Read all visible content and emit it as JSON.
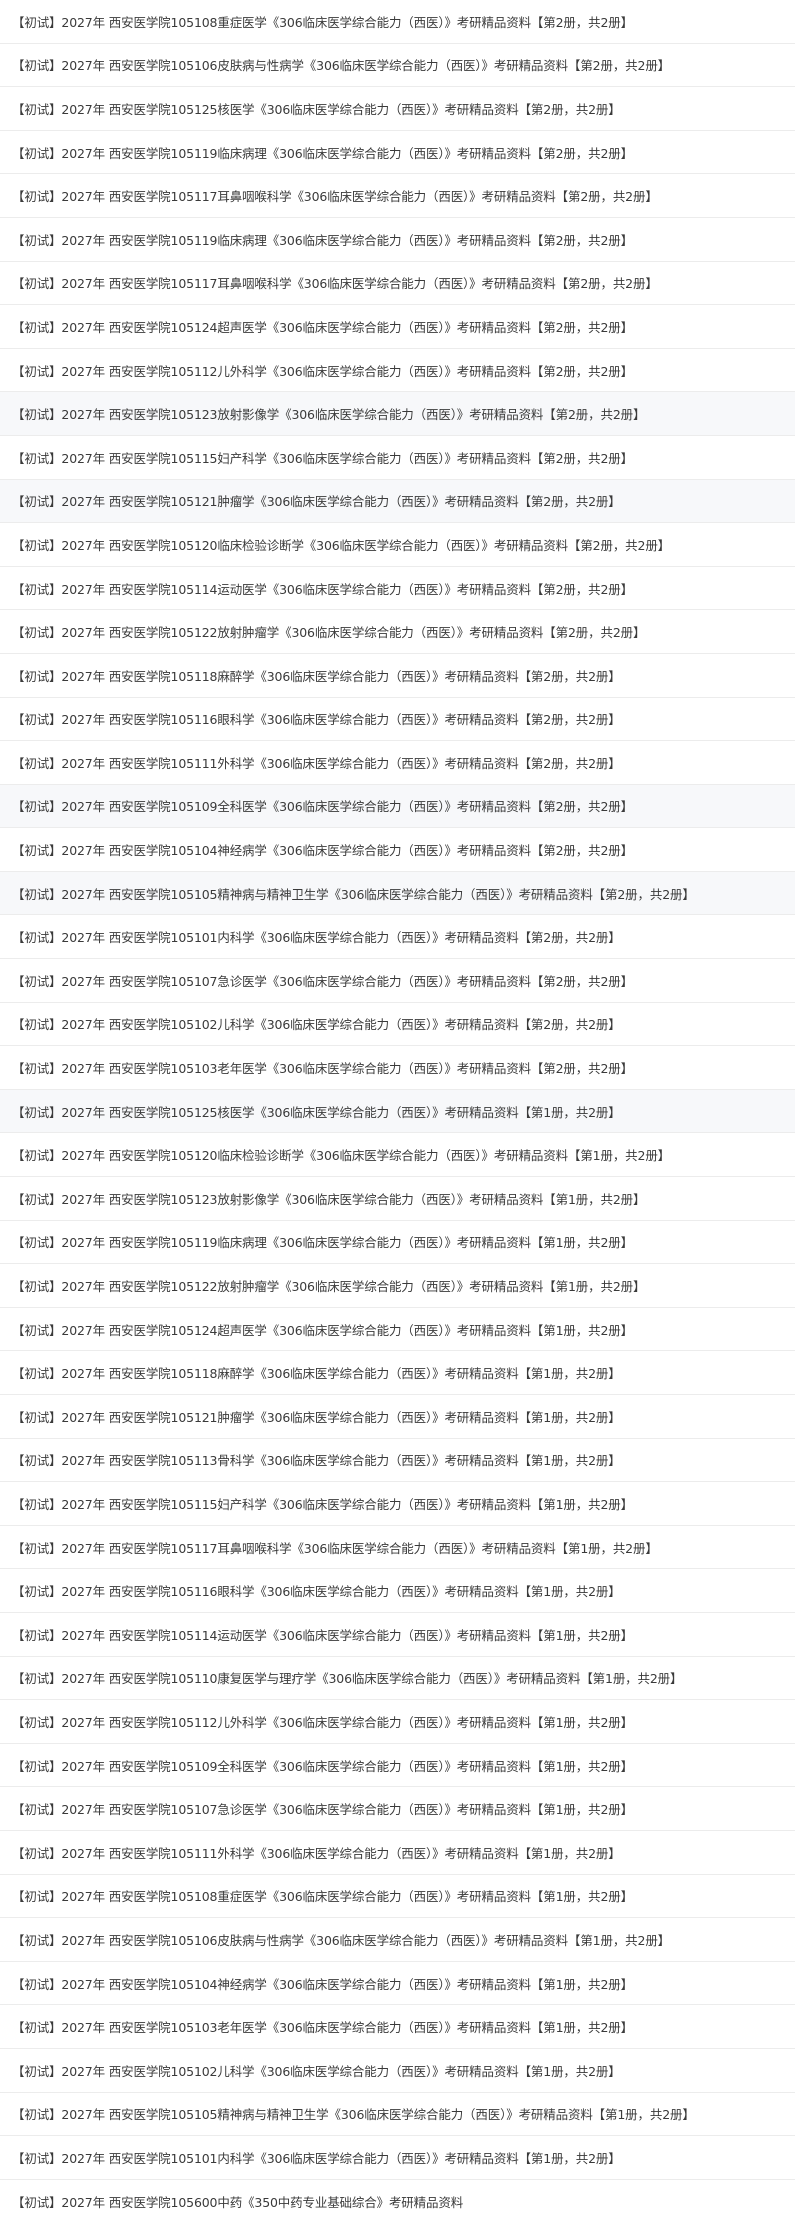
{
  "items": [
    "【初试】2027年 西安医学院105108重症医学《306临床医学综合能力（西医）》考研精品资料【第2册，共2册】",
    "【初试】2027年 西安医学院105106皮肤病与性病学《306临床医学综合能力（西医）》考研精品资料【第2册，共2册】",
    "【初试】2027年 西安医学院105125核医学《306临床医学综合能力（西医）》考研精品资料【第2册，共2册】",
    "【初试】2027年 西安医学院105119临床病理《306临床医学综合能力（西医）》考研精品资料【第2册，共2册】",
    "【初试】2027年 西安医学院105117耳鼻咽喉科学《306临床医学综合能力（西医）》考研精品资料【第2册，共2册】",
    "【初试】2027年 西安医学院105119临床病理《306临床医学综合能力（西医）》考研精品资料【第2册，共2册】",
    "【初试】2027年 西安医学院105117耳鼻咽喉科学《306临床医学综合能力（西医）》考研精品资料【第2册，共2册】",
    "【初试】2027年 西安医学院105124超声医学《306临床医学综合能力（西医）》考研精品资料【第2册，共2册】",
    "【初试】2027年 西安医学院105112儿外科学《306临床医学综合能力（西医）》考研精品资料【第2册，共2册】",
    "【初试】2027年 西安医学院105123放射影像学《306临床医学综合能力（西医）》考研精品资料【第2册，共2册】",
    "【初试】2027年 西安医学院105115妇产科学《306临床医学综合能力（西医）》考研精品资料【第2册，共2册】",
    "【初试】2027年 西安医学院105121肿瘤学《306临床医学综合能力（西医）》考研精品资料【第2册，共2册】",
    "【初试】2027年 西安医学院105120临床检验诊断学《306临床医学综合能力（西医）》考研精品资料【第2册，共2册】",
    "【初试】2027年 西安医学院105114运动医学《306临床医学综合能力（西医）》考研精品资料【第2册，共2册】",
    "【初试】2027年 西安医学院105122放射肿瘤学《306临床医学综合能力（西医）》考研精品资料【第2册，共2册】",
    "【初试】2027年 西安医学院105118麻醉学《306临床医学综合能力（西医）》考研精品资料【第2册，共2册】",
    "【初试】2027年 西安医学院105116眼科学《306临床医学综合能力（西医）》考研精品资料【第2册，共2册】",
    "【初试】2027年 西安医学院105111外科学《306临床医学综合能力（西医）》考研精品资料【第2册，共2册】",
    "【初试】2027年 西安医学院105109全科医学《306临床医学综合能力（西医）》考研精品资料【第2册，共2册】",
    "【初试】2027年 西安医学院105104神经病学《306临床医学综合能力（西医）》考研精品资料【第2册，共2册】",
    "【初试】2027年 西安医学院105105精神病与精神卫生学《306临床医学综合能力（西医）》考研精品资料【第2册，共2册】",
    "【初试】2027年 西安医学院105101内科学《306临床医学综合能力（西医）》考研精品资料【第2册，共2册】",
    "【初试】2027年 西安医学院105107急诊医学《306临床医学综合能力（西医）》考研精品资料【第2册，共2册】",
    "【初试】2027年 西安医学院105102儿科学《306临床医学综合能力（西医）》考研精品资料【第2册，共2册】",
    "【初试】2027年 西安医学院105103老年医学《306临床医学综合能力（西医）》考研精品资料【第2册，共2册】",
    "【初试】2027年 西安医学院105125核医学《306临床医学综合能力（西医）》考研精品资料【第1册，共2册】",
    "【初试】2027年 西安医学院105120临床检验诊断学《306临床医学综合能力（西医）》考研精品资料【第1册，共2册】",
    "【初试】2027年 西安医学院105123放射影像学《306临床医学综合能力（西医）》考研精品资料【第1册，共2册】",
    "【初试】2027年 西安医学院105119临床病理《306临床医学综合能力（西医）》考研精品资料【第1册，共2册】",
    "【初试】2027年 西安医学院105122放射肿瘤学《306临床医学综合能力（西医）》考研精品资料【第1册，共2册】",
    "【初试】2027年 西安医学院105124超声医学《306临床医学综合能力（西医）》考研精品资料【第1册，共2册】",
    "【初试】2027年 西安医学院105118麻醉学《306临床医学综合能力（西医）》考研精品资料【第1册，共2册】",
    "【初试】2027年 西安医学院105121肿瘤学《306临床医学综合能力（西医）》考研精品资料【第1册，共2册】",
    "【初试】2027年 西安医学院105113骨科学《306临床医学综合能力（西医）》考研精品资料【第1册，共2册】",
    "【初试】2027年 西安医学院105115妇产科学《306临床医学综合能力（西医）》考研精品资料【第1册，共2册】",
    "【初试】2027年 西安医学院105117耳鼻咽喉科学《306临床医学综合能力（西医）》考研精品资料【第1册，共2册】",
    "【初试】2027年 西安医学院105116眼科学《306临床医学综合能力（西医）》考研精品资料【第1册，共2册】",
    "【初试】2027年 西安医学院105114运动医学《306临床医学综合能力（西医）》考研精品资料【第1册，共2册】",
    "【初试】2027年 西安医学院105110康复医学与理疗学《306临床医学综合能力（西医）》考研精品资料【第1册，共2册】",
    "【初试】2027年 西安医学院105112儿外科学《306临床医学综合能力（西医）》考研精品资料【第1册，共2册】",
    "【初试】2027年 西安医学院105109全科医学《306临床医学综合能力（西医）》考研精品资料【第1册，共2册】",
    "【初试】2027年 西安医学院105107急诊医学《306临床医学综合能力（西医）》考研精品资料【第1册，共2册】",
    "【初试】2027年 西安医学院105111外科学《306临床医学综合能力（西医）》考研精品资料【第1册，共2册】",
    "【初试】2027年 西安医学院105108重症医学《306临床医学综合能力（西医）》考研精品资料【第1册，共2册】",
    "【初试】2027年 西安医学院105106皮肤病与性病学《306临床医学综合能力（西医）》考研精品资料【第1册，共2册】",
    "【初试】2027年 西安医学院105104神经病学《306临床医学综合能力（西医）》考研精品资料【第1册，共2册】",
    "【初试】2027年 西安医学院105103老年医学《306临床医学综合能力（西医）》考研精品资料【第1册，共2册】",
    "【初试】2027年 西安医学院105102儿科学《306临床医学综合能力（西医）》考研精品资料【第1册，共2册】",
    "【初试】2027年 西安医学院105105精神病与精神卫生学《306临床医学综合能力（西医）》考研精品资料【第1册，共2册】",
    "【初试】2027年 西安医学院105101内科学《306临床医学综合能力（西医）》考研精品资料【第1册，共2册】",
    "【初试】2027年 西安医学院105600中药《350中药专业基础综合》考研精品资料"
  ],
  "colors": {
    "text": "#3a3a3a",
    "divider": "#ececec",
    "row_shaded": "#f7f8fa"
  }
}
